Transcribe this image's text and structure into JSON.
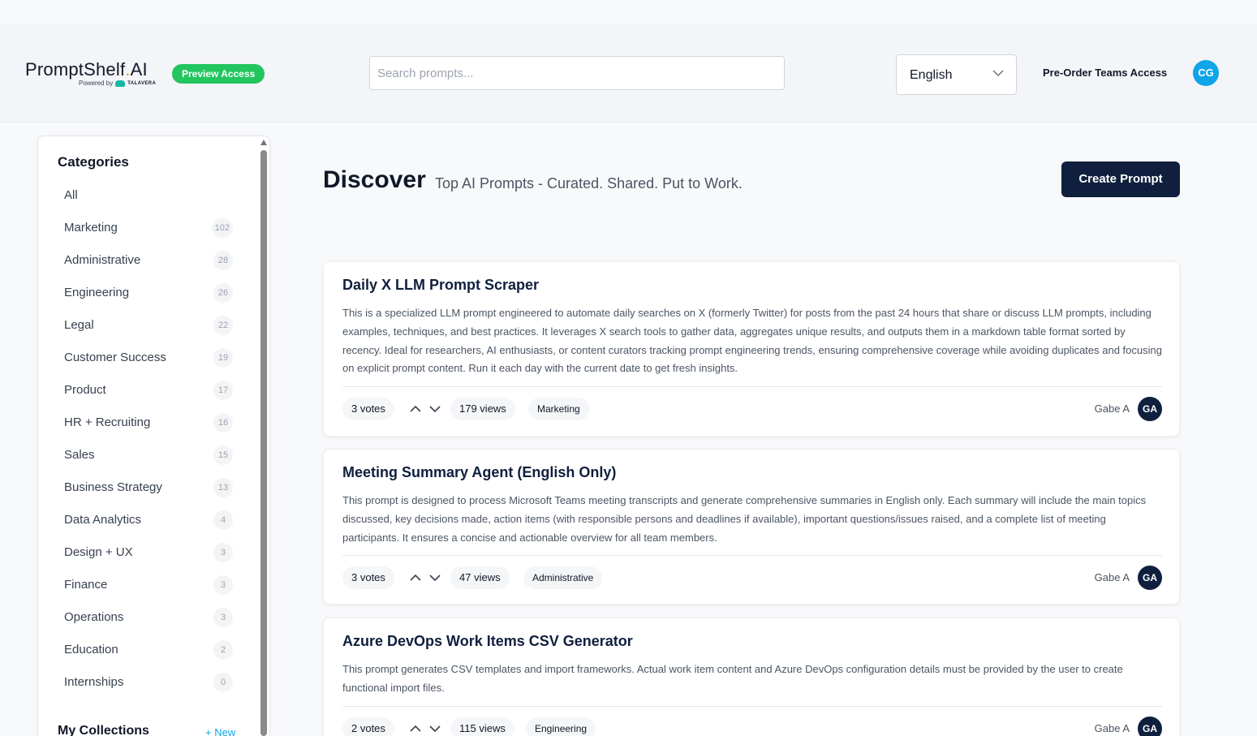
{
  "header": {
    "logo_main": "PromptShelf",
    "logo_dot": ".",
    "logo_ai": "AI",
    "logo_powered": "Powered by",
    "logo_brand": "TALAVERA",
    "preview_badge": "Preview Access",
    "search_placeholder": "Search prompts...",
    "language": "English",
    "preorder": "Pre-Order Teams Access",
    "user_initials": "CG"
  },
  "sidebar": {
    "title": "Categories",
    "items": [
      {
        "label": "All",
        "count": ""
      },
      {
        "label": "Marketing",
        "count": "102"
      },
      {
        "label": "Administrative",
        "count": "28"
      },
      {
        "label": "Engineering",
        "count": "26"
      },
      {
        "label": "Legal",
        "count": "22"
      },
      {
        "label": "Customer Success",
        "count": "19"
      },
      {
        "label": "Product",
        "count": "17"
      },
      {
        "label": "HR + Recruiting",
        "count": "16"
      },
      {
        "label": "Sales",
        "count": "15"
      },
      {
        "label": "Business Strategy",
        "count": "13"
      },
      {
        "label": "Data Analytics",
        "count": "4"
      },
      {
        "label": "Design + UX",
        "count": "3"
      },
      {
        "label": "Finance",
        "count": "3"
      },
      {
        "label": "Operations",
        "count": "3"
      },
      {
        "label": "Education",
        "count": "2"
      },
      {
        "label": "Internships",
        "count": "0"
      }
    ],
    "collections_title": "My Collections",
    "collections_new": "+ New"
  },
  "main": {
    "title": "Discover",
    "subtitle": "Top AI Prompts - Curated. Shared. Put to Work.",
    "create_button": "Create Prompt"
  },
  "cards": [
    {
      "title": "Daily X LLM Prompt Scraper",
      "description": "This is a specialized LLM prompt engineered to automate daily searches on X (formerly Twitter) for posts from the past 24 hours that share or discuss LLM prompts, including examples, techniques, and best practices. It leverages X search tools to gather data, aggregates unique results, and outputs them in a markdown table format sorted by recency. Ideal for researchers, AI enthusiasts, or content curators tracking prompt engineering trends, ensuring comprehensive coverage while avoiding duplicates and focusing on explicit prompt content. Run it each day with the current date to get fresh insights.",
      "votes": "3 votes",
      "views": "179 views",
      "tag": "Marketing",
      "author": "Gabe A",
      "author_initials": "GA"
    },
    {
      "title": "Meeting Summary Agent (English Only)",
      "description": "This prompt is designed to process Microsoft Teams meeting transcripts and generate comprehensive summaries in English only. Each summary will include the main topics discussed, key decisions made, action items (with responsible persons and deadlines if available), important questions/issues raised, and a complete list of meeting participants. It ensures a concise and actionable overview for all team members.",
      "votes": "3 votes",
      "views": "47 views",
      "tag": "Administrative",
      "author": "Gabe A",
      "author_initials": "GA"
    },
    {
      "title": "Azure DevOps Work Items CSV Generator",
      "description": "This prompt generates CSV templates and import frameworks. Actual work item content and Azure DevOps configuration details must be provided by the user to create functional import files.",
      "votes": "2 votes",
      "views": "115 views",
      "tag": "Engineering",
      "author": "Gabe A",
      "author_initials": "GA"
    }
  ]
}
